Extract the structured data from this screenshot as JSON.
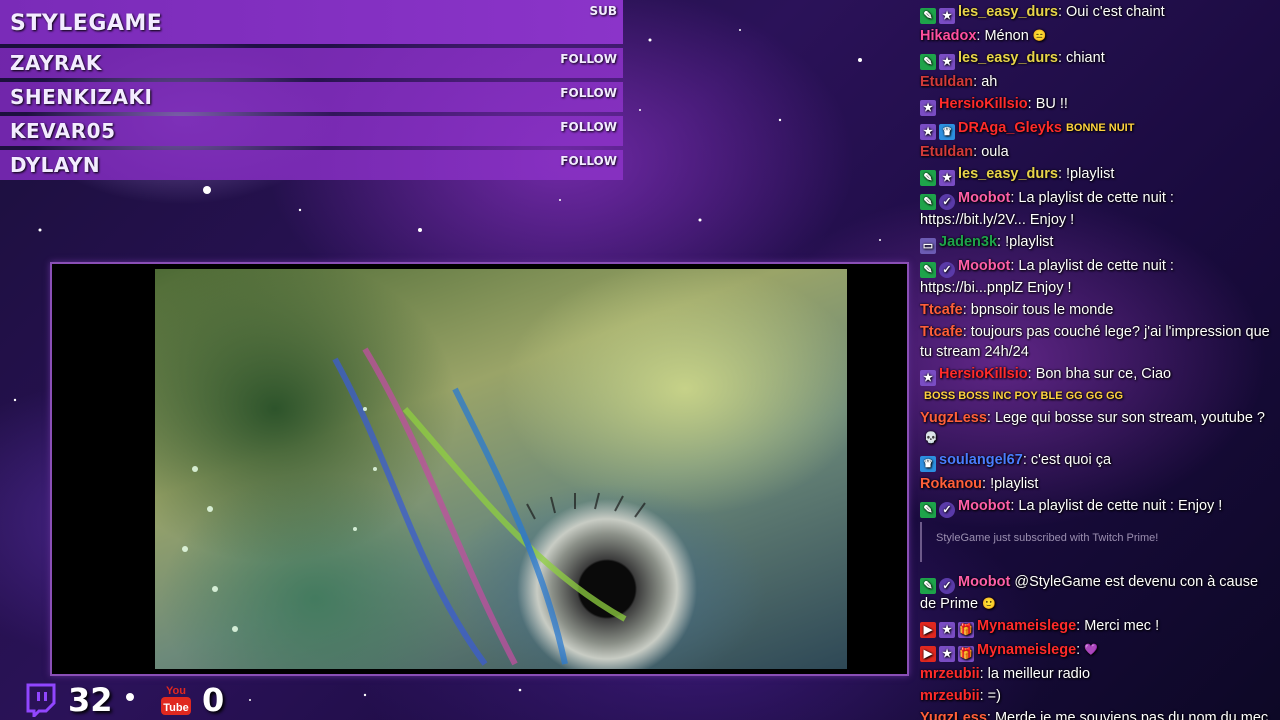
{
  "events": {
    "main": {
      "name": "STYLEGAME",
      "tag": "SUB"
    },
    "rows": [
      {
        "name": "ZAYRAK",
        "tag": "FOLLOW"
      },
      {
        "name": "SHENKIZAKI",
        "tag": "FOLLOW"
      },
      {
        "name": "KEVAR05",
        "tag": "FOLLOW"
      },
      {
        "name": "DYLAYN",
        "tag": "FOLLOW"
      }
    ]
  },
  "counters": {
    "twitch": {
      "icon": "twitch-icon",
      "value": "32"
    },
    "youtube": {
      "icon": "youtube-icon",
      "icon_text": "You Tube",
      "value": "0"
    }
  },
  "chat": {
    "messages": [
      {
        "badges": [
          "mod",
          "star"
        ],
        "user": "les_easy_durs",
        "color": "#e8d44a",
        "text": ": Oui c'est chaint"
      },
      {
        "badges": [],
        "user": "Hikadox",
        "color": "#ff4fa0",
        "text": ": Ménon",
        "emote": "😑"
      },
      {
        "badges": [
          "mod",
          "star"
        ],
        "user": "les_easy_durs",
        "color": "#e8d44a",
        "text": ": chiant"
      },
      {
        "badges": [],
        "user": "Etuldan",
        "color": "#d33a3a",
        "text": ": ah"
      },
      {
        "badges": [
          "star"
        ],
        "user": "HersioKillsio",
        "color": "#ff2b2b",
        "text": ": BU !!"
      },
      {
        "badges": [
          "star",
          "sub"
        ],
        "user": "DRAga_Gleyks",
        "color": "#ff2b2b",
        "text": "",
        "emote": "BONNE NUIT"
      },
      {
        "badges": [],
        "user": "Etuldan",
        "color": "#d33a3a",
        "text": ": oula"
      },
      {
        "badges": [
          "mod",
          "star"
        ],
        "user": "les_easy_durs",
        "color": "#e8d44a",
        "text": ": !playlist"
      },
      {
        "badges": [
          "mod",
          "verified"
        ],
        "user": "Moobot",
        "color": "#ff5fa8",
        "text": ": La playlist de cette nuit : https://bit.ly/2V... Enjoy !"
      },
      {
        "badges": [
          "tv"
        ],
        "user": "Jaden3k",
        "color": "#1ea34a",
        "text": ": !playlist"
      },
      {
        "badges": [
          "mod",
          "verified"
        ],
        "user": "Moobot",
        "color": "#ff5fa8",
        "text": ": La playlist de cette nuit : https://bi...pnplZ Enjoy !"
      },
      {
        "badges": [],
        "user": "Ttcafe",
        "color": "#ff5f3a",
        "text": ": bpnsoir tous le monde"
      },
      {
        "badges": [],
        "user": "Ttcafe",
        "color": "#ff5f3a",
        "text": ": toujours pas couché lege? j'ai l'impression que tu stream 24h/24"
      },
      {
        "badges": [
          "star"
        ],
        "user": "HersioKillsio",
        "color": "#ff2b2b",
        "text": ": Bon bha sur ce, Ciao",
        "emote": "BOSS BOSS INC POY BLE GG GG GG"
      },
      {
        "badges": [],
        "user": "YugzLess",
        "color": "#ff5f3a",
        "text": ": Lege qui bosse sur son stream, youtube ?",
        "emote": "💀"
      },
      {
        "badges": [
          "sub"
        ],
        "user": "soulangel67",
        "color": "#4a7dff",
        "text": ": c'est quoi ça"
      },
      {
        "badges": [],
        "user": "Rokanou",
        "color": "#ff5f3a",
        "text": ": !playlist"
      },
      {
        "badges": [
          "mod",
          "verified"
        ],
        "user": "Moobot",
        "color": "#ff5fa8",
        "text": ": La playlist de cette nuit : Enjoy !"
      },
      {
        "badges": [
          "mod",
          "verified"
        ],
        "user": "Moobot",
        "color": "#ff5fa8",
        "text": " @StyleGame est devenu con à cause de Prime",
        "emote": "🙂"
      },
      {
        "badges": [
          "yt",
          "star",
          "gift"
        ],
        "user": "Mynameislege",
        "color": "#ff2b2b",
        "text": ": Merci mec !"
      },
      {
        "badges": [
          "yt",
          "star",
          "gift"
        ],
        "user": "Mynameislege",
        "color": "#ff2b2b",
        "text": ":",
        "emote": "💜"
      },
      {
        "badges": [],
        "user": "mrzeubii",
        "color": "#ff2b2b",
        "text": ": la meilleur radio"
      },
      {
        "badges": [],
        "user": "mrzeubii",
        "color": "#ff2b2b",
        "text": ": =)"
      },
      {
        "badges": [],
        "user": "YugzLess",
        "color": "#ff5f3a",
        "text": ": Merde je me souviens pas du nom du mec qui beatbox x)"
      }
    ],
    "system": {
      "user": "StyleGame",
      "text": "just subscribed with Twitch Prime!"
    }
  },
  "colors": {
    "panel": "#8b34c9",
    "accent": "#7a2bb8"
  }
}
